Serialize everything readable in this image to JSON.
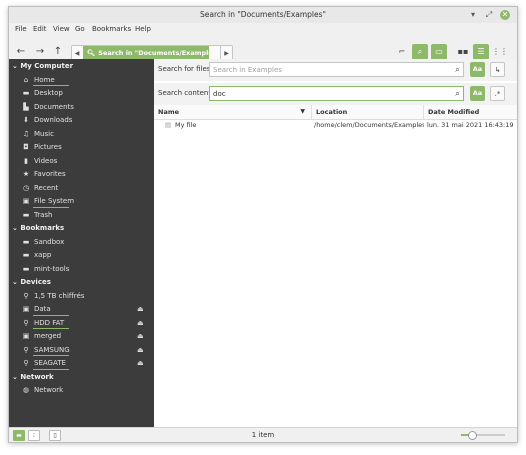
{
  "window": {
    "title": "Search in \"Documents/Examples\"",
    "controls": [
      "minimize-icon",
      "maximize-icon",
      "close-icon"
    ]
  },
  "menu": [
    "File",
    "Edit",
    "View",
    "Go",
    "Bookmarks",
    "Help"
  ],
  "toolbar": {
    "path_label": "Search in \"Documents/Examples\"",
    "accent": "#8fb96a"
  },
  "sidebar": {
    "sections": [
      {
        "title": "My Computer",
        "items": [
          {
            "label": "Home",
            "icon": "home-icon",
            "underline": true
          },
          {
            "label": "Desktop",
            "icon": "folder-icon"
          },
          {
            "label": "Documents",
            "icon": "document-icon"
          },
          {
            "label": "Downloads",
            "icon": "download-icon"
          },
          {
            "label": "Music",
            "icon": "music-icon"
          },
          {
            "label": "Pictures",
            "icon": "camera-icon"
          },
          {
            "label": "Videos",
            "icon": "film-icon"
          },
          {
            "label": "Favorites",
            "icon": "star-icon"
          },
          {
            "label": "Recent",
            "icon": "clock-icon"
          },
          {
            "label": "File System",
            "icon": "drive-icon",
            "underline": true
          },
          {
            "label": "Trash",
            "icon": "trash-icon"
          }
        ]
      },
      {
        "title": "Bookmarks",
        "items": [
          {
            "label": "Sandbox",
            "icon": "folder-icon"
          },
          {
            "label": "xapp",
            "icon": "folder-icon"
          },
          {
            "label": "mint-tools",
            "icon": "folder-icon"
          }
        ]
      },
      {
        "title": "Devices",
        "items": [
          {
            "label": "1,5 TB chiffrés",
            "icon": "usb-icon"
          },
          {
            "label": "Data",
            "icon": "drive-icon",
            "underline": true,
            "eject": true
          },
          {
            "label": "HDD FAT",
            "icon": "usb-icon",
            "underline": true,
            "eject": true
          },
          {
            "label": "merged",
            "icon": "drive-icon",
            "eject": true
          },
          {
            "label": "SAMSUNG",
            "icon": "usb-icon",
            "underline": true,
            "eject": true
          },
          {
            "label": "SEAGATE",
            "icon": "usb-icon",
            "underline": true,
            "eject": true
          }
        ]
      },
      {
        "title": "Network",
        "items": [
          {
            "label": "Network",
            "icon": "network-icon"
          }
        ]
      }
    ]
  },
  "search": {
    "files_label": "Search for files:",
    "files_placeholder": "Search in Examples",
    "files_value": "",
    "content_label": "Search content:",
    "content_value": "doc",
    "case_button": "Aa",
    "regex_button": ".*"
  },
  "table": {
    "columns": [
      "Name",
      "Location",
      "Date Modified"
    ],
    "rows": [
      {
        "name": "My file",
        "location": "/home/clem/Documents/Examples",
        "date": "lun. 31 mai 2021 16:43:19"
      }
    ]
  },
  "status": {
    "text": "1 item",
    "zoom_fraction": 0.25
  }
}
